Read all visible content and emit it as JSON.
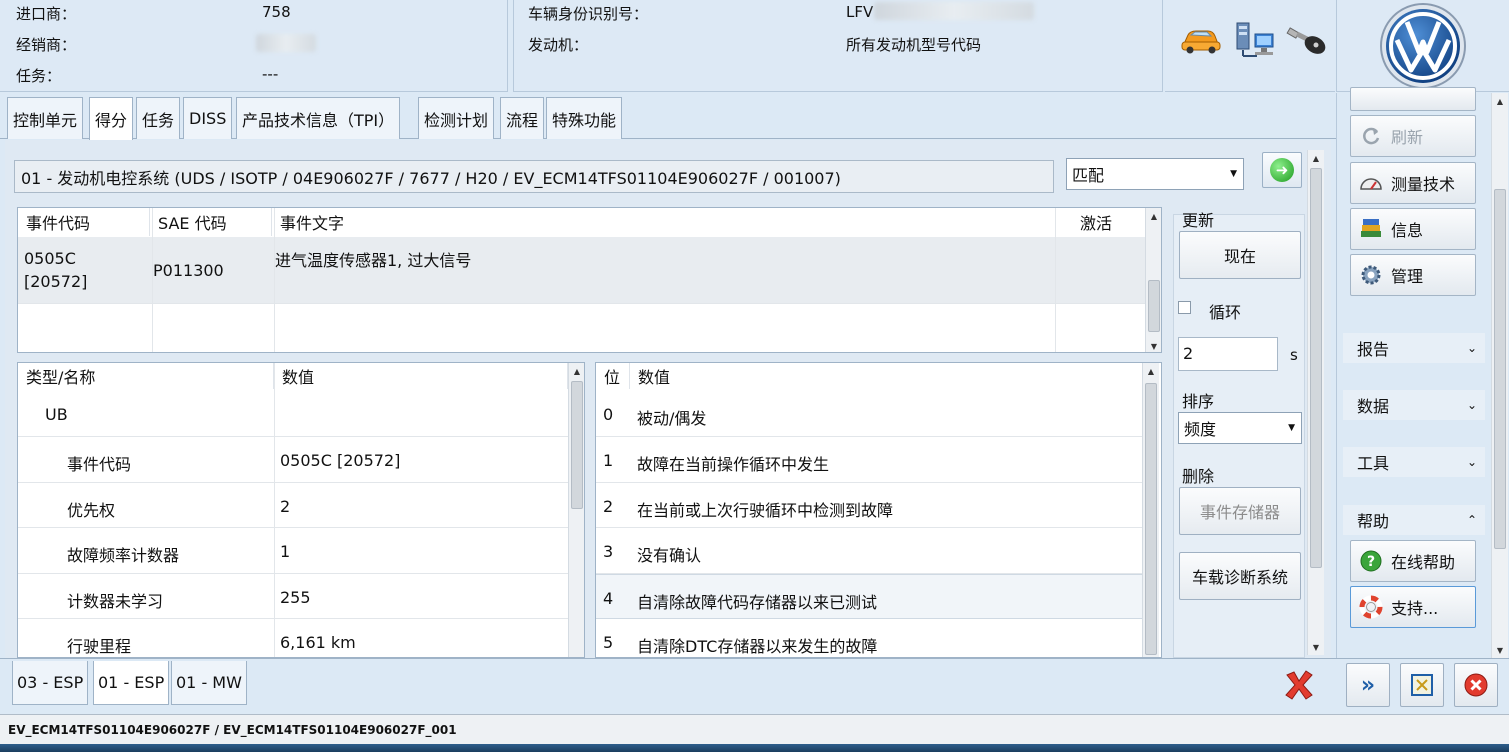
{
  "header": {
    "importer_label": "进口商：",
    "importer_value": "758",
    "dealer_label": "经销商：",
    "task_label": "任务：",
    "task_value": "---",
    "vin_label": "车辆身份识别号：",
    "vin_value": "LFV",
    "engine_label": "发动机：",
    "engine_value": "所有发动机型号代码"
  },
  "tabs": [
    "控制单元",
    "得分",
    "任务",
    "DISS",
    "产品技术信息（TPI）",
    "检测计划",
    "流程",
    "特殊功能"
  ],
  "ecu": {
    "title": "01 - 发动机电控系统  (UDS / ISOTP / 04E906027F  / 7677 / H20 / EV_ECM14TFS01104E906027F / 001007)",
    "mode_select": "匹配"
  },
  "event_table": {
    "headers": [
      "事件代码",
      "SAE 代码",
      "事件文字",
      "激活"
    ],
    "rows": [
      {
        "code": "0505C",
        "code2": "[20572]",
        "sae": "P011300",
        "text": "进气温度传感器1, 过大信号",
        "active": ""
      }
    ]
  },
  "detail_table": {
    "headers": [
      "类型/名称",
      "数值"
    ],
    "rows": [
      {
        "name": "UB",
        "value": ""
      },
      {
        "name": "事件代码",
        "value": "0505C [20572]"
      },
      {
        "name": "优先权",
        "value": "2"
      },
      {
        "name": "故障频率计数器",
        "value": "1"
      },
      {
        "name": "计数器未学习",
        "value": "255"
      },
      {
        "name": "行驶里程",
        "value": "6,161 km"
      }
    ]
  },
  "bits_table": {
    "headers": [
      "位",
      "数值"
    ],
    "rows": [
      {
        "bit": "0",
        "value": "被动/偶发"
      },
      {
        "bit": "1",
        "value": "故障在当前操作循环中发生"
      },
      {
        "bit": "2",
        "value": "在当前或上次行驶循环中检测到故障"
      },
      {
        "bit": "3",
        "value": "没有确认"
      },
      {
        "bit": "4",
        "value": "自清除故障代码存储器以来已测试"
      },
      {
        "bit": "5",
        "value": "自清除DTC存储器以来发生的故障"
      }
    ]
  },
  "controls": {
    "update_label": "更新",
    "now_button": "现在",
    "loop_label": "循环",
    "interval_value": "2",
    "interval_unit": "s",
    "sort_label": "排序",
    "sort_select": "频度",
    "delete_label": "删除",
    "event_memory_button": "事件存储器",
    "obd_button": "车载诊断系统"
  },
  "sidebar": {
    "refresh": "刷新",
    "measure": "测量技术",
    "info": "信息",
    "manage": "管理",
    "report": "报告",
    "data": "数据",
    "tools": "工具",
    "help": "帮助",
    "online_help": "在线帮助",
    "support": "支持..."
  },
  "bottom_tabs": [
    "03 - ESP",
    "01 - ESP",
    "01 - MW"
  ],
  "status": "EV_ECM14TFS01104E906027F / EV_ECM14TFS01104E906027F_001",
  "colors": {
    "accent": "#1f5fa8",
    "close_red": "#e23b2e",
    "go_green": "#1d9a1d"
  }
}
